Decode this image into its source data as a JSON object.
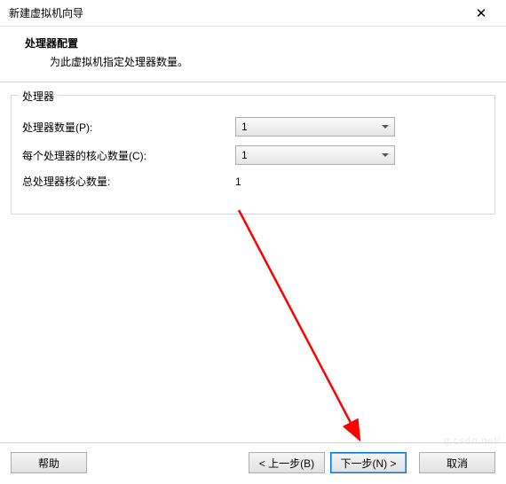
{
  "window": {
    "title": "新建虚拟机向导",
    "close": "✕"
  },
  "header": {
    "title": "处理器配置",
    "subtitle": "为此虚拟机指定处理器数量。"
  },
  "group": {
    "legend": "处理器",
    "processor_count_label": "处理器数量(P):",
    "processor_count_value": "1",
    "cores_per_label": "每个处理器的核心数量(C):",
    "cores_per_value": "1",
    "total_label": "总处理器核心数量:",
    "total_value": "1"
  },
  "footer": {
    "help": "帮助",
    "back": "< 上一步(B)",
    "next": "下一步(N) >",
    "cancel": "取消"
  },
  "watermark": "g.csdn.net/"
}
